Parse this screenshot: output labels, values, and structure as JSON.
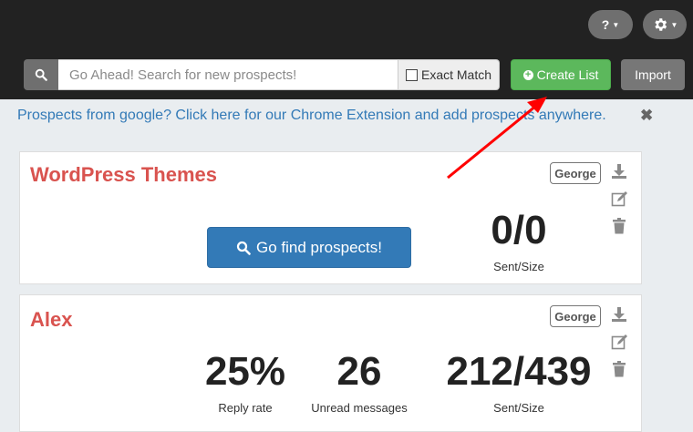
{
  "topbar": {
    "help_label": "?",
    "search_placeholder": "Go Ahead! Search for new prospects!",
    "exact_match_label": "Exact Match",
    "create_list_label": "Create List",
    "import_label": "Import"
  },
  "banner": {
    "text": "Prospects from google? Click here for our Chrome Extension and add prospects anywhere.",
    "close_glyph": "✖"
  },
  "cards": [
    {
      "title": "WordPress Themes",
      "owner": "George",
      "button_label": "Go find prospects!",
      "stats": [
        {
          "value": "0/0",
          "label": "Sent/Size"
        }
      ]
    },
    {
      "title": "Alex",
      "owner": "George",
      "stats": [
        {
          "value": "25%",
          "label": "Reply rate"
        },
        {
          "value": "26",
          "label": "Unread messages"
        },
        {
          "value": "212/439",
          "label": "Sent/Size"
        }
      ]
    }
  ],
  "icons": [
    "search-icon",
    "gear-icon",
    "help-icon",
    "plus-circle-icon",
    "download-icon",
    "edit-icon",
    "trash-icon",
    "close-icon"
  ],
  "colors": {
    "accent_green": "#5cb85c",
    "accent_blue": "#337ab7",
    "title_red": "#d9534f",
    "annotation_red": "#ff0000"
  }
}
